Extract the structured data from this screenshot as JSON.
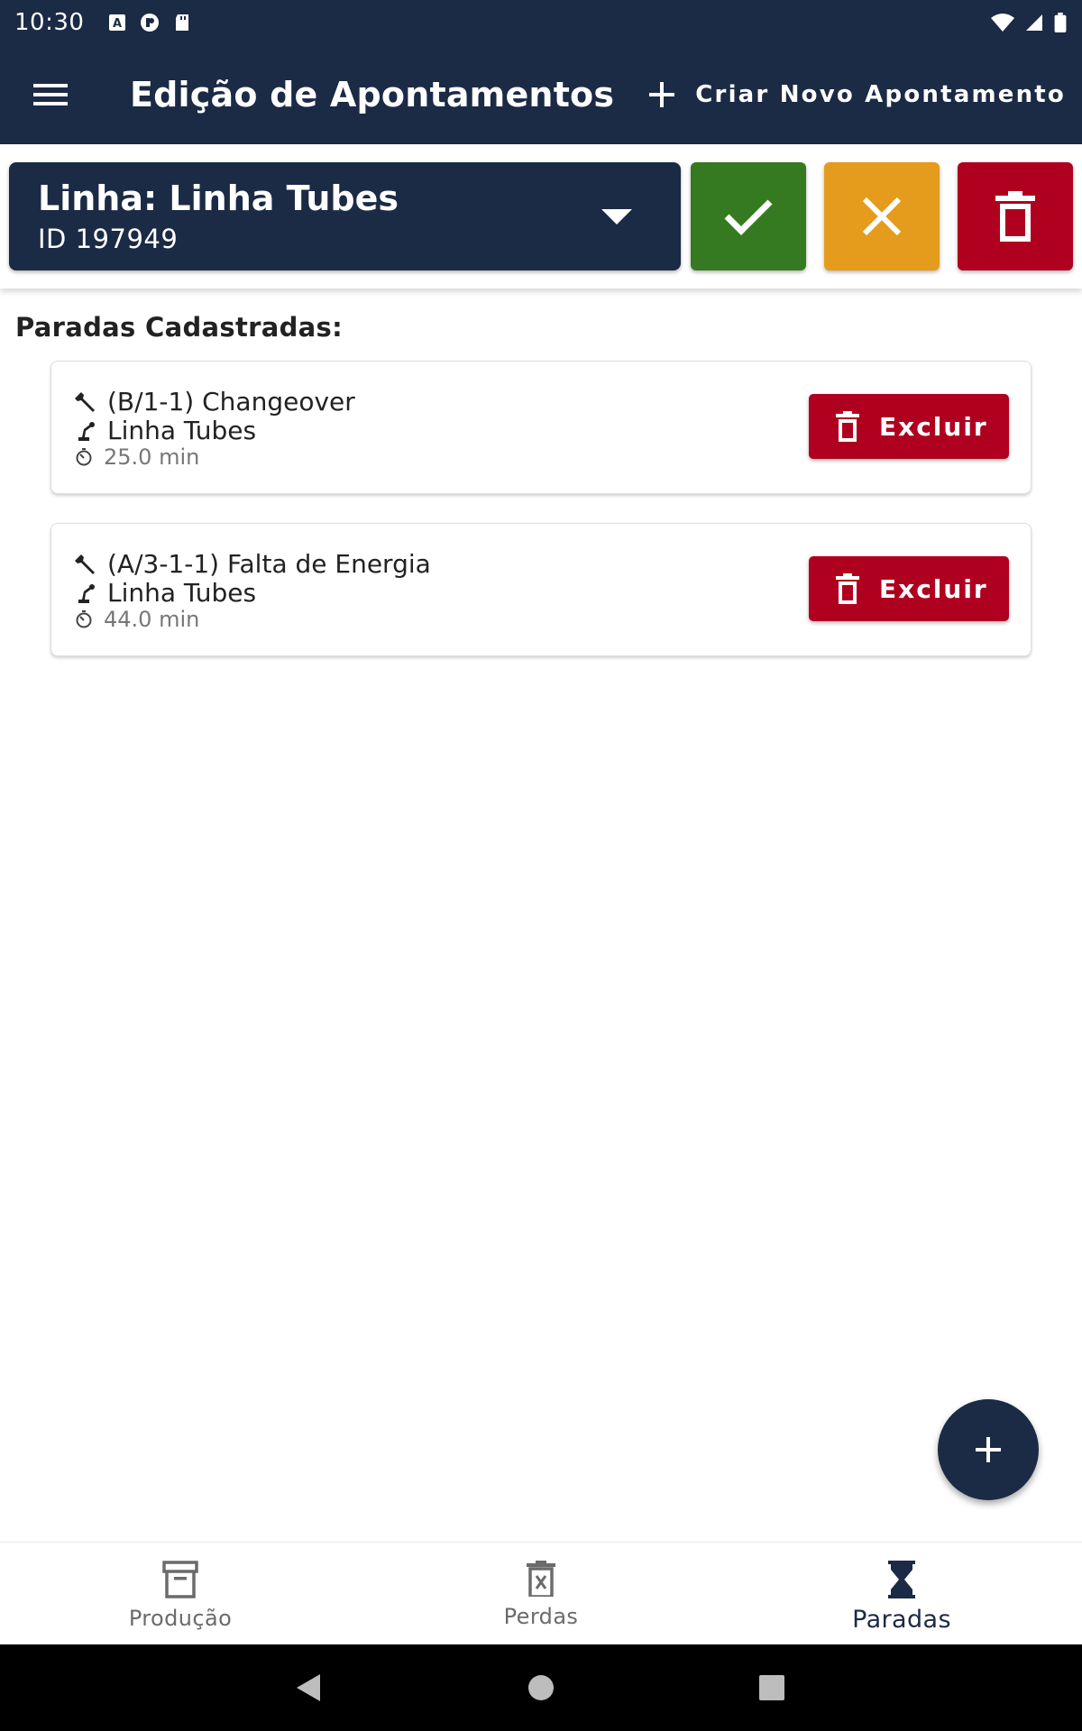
{
  "status_bar": {
    "time": "10:30"
  },
  "app_bar": {
    "title": "Edição de Apontamentos",
    "new_label": "Criar Novo Apontamento"
  },
  "header": {
    "line_name": "Linha: Linha Tubes",
    "line_id": "ID 197949"
  },
  "section_title": "Paradas Cadastradas:",
  "stops": [
    {
      "code": "(B/1-1) Changeover",
      "line": "Linha Tubes",
      "duration": "25.0 min",
      "delete_label": "Excluir"
    },
    {
      "code": "(A/3-1-1) Falta de Energia",
      "line": "Linha Tubes",
      "duration": "44.0 min",
      "delete_label": "Excluir"
    }
  ],
  "bottom_nav": [
    {
      "label": "Produção",
      "icon": "archive-icon",
      "active": false
    },
    {
      "label": "Perdas",
      "icon": "trash-x-icon",
      "active": false
    },
    {
      "label": "Paradas",
      "icon": "hourglass-icon",
      "active": true
    }
  ],
  "colors": {
    "primary": "#1b2a45",
    "confirm": "#357a20",
    "cancel": "#e59b1c",
    "danger": "#b0001f"
  }
}
